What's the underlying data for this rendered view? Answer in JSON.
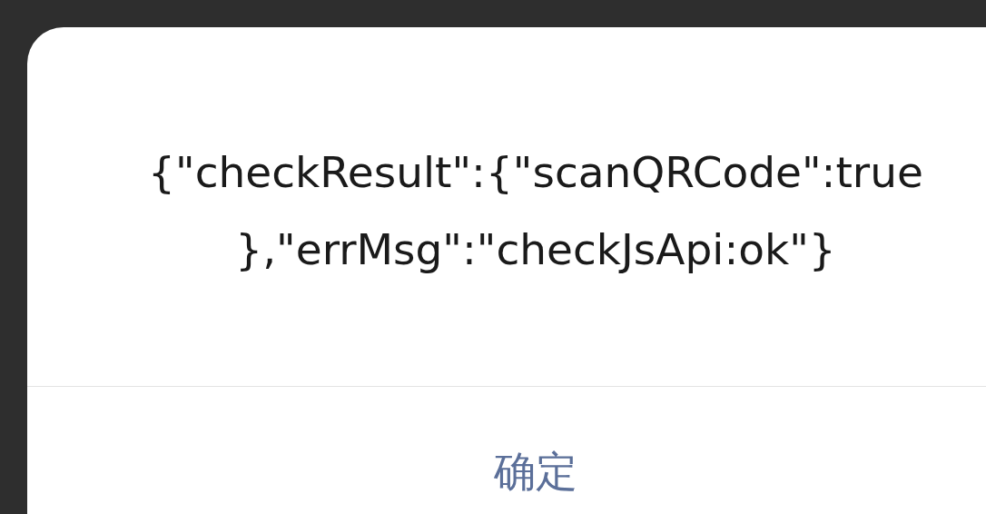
{
  "dialog": {
    "message": [
      "{\"checkResult\":{\"scanQRCode\":true",
      "},\"errMsg\":\"checkJsApi:ok\"}"
    ],
    "buttons": [
      {
        "label": "确定",
        "kind": "primary"
      }
    ]
  }
}
